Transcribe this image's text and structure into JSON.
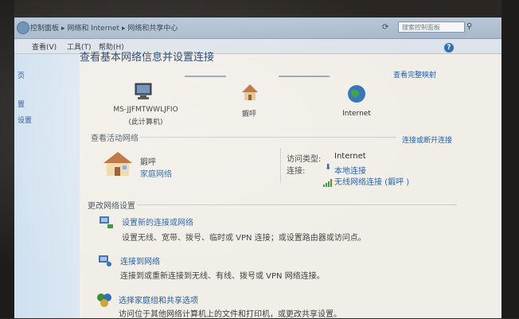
{
  "window": {
    "breadcrumbs": [
      "控制面板",
      "网络和 Internet",
      "网络和共享中心"
    ],
    "search_placeholder": "搜索控制面板"
  },
  "menu": [
    "查看(V)",
    "工具(T)",
    "帮助(H)"
  ],
  "left_pane": [
    "页",
    "置",
    "设置"
  ],
  "page": {
    "title": "查看基本网络信息并设置连接",
    "full_map_link": "查看完整映射"
  },
  "network_map": {
    "computer_name": "MS-JJFMTWWLJFIO",
    "computer_sub": "(此计算机)",
    "network_name": "鍜呯",
    "internet_label": "Internet"
  },
  "active_networks": {
    "header": "查看活动网络",
    "connect_link": "连接或断开连接",
    "network_title": "鍜呯",
    "network_type": "家庭网络",
    "access_type_label": "访问类型:",
    "access_type_value": "Internet",
    "connections_label": "连接:",
    "connection_1": "本地连接",
    "connection_2": "无线网络连接 (鍜呯 )"
  },
  "change_settings": {
    "header": "更改网络设置",
    "items": [
      {
        "title": "设置新的连接或网络",
        "desc": "设置无线、宽带、拨号、临时或 VPN 连接；或设置路由器或访问点。"
      },
      {
        "title": "连接到网络",
        "desc": "连接到或重新连接到无线、有线、拨号或 VPN 网络连接。"
      },
      {
        "title": "选择家庭组和共享选项",
        "desc": "访问位于其他网络计算机上的文件和打印机，或更改共享设置。"
      }
    ]
  },
  "colors": {
    "link": "#1e5ca8",
    "title": "#1a3a6b",
    "background": "#f1eee7"
  },
  "icons": [
    "computer-icon",
    "house-icon",
    "globe-icon",
    "signal-icon",
    "network-setup-icon",
    "connect-icon",
    "homegroup-icon"
  ]
}
